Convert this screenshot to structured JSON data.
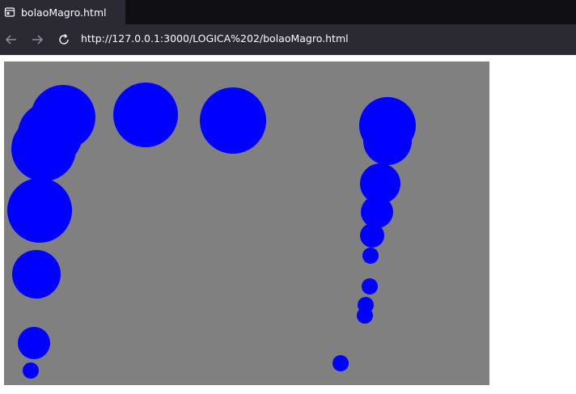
{
  "tab": {
    "title": "bolaoMagro.html",
    "icon": "page-icon"
  },
  "nav": {
    "back_icon": "back-arrow-icon",
    "forward_icon": "forward-arrow-icon",
    "reload_icon": "reload-icon",
    "url": "http://127.0.0.1:3000/LOGICA%202/bolaoMagro.html"
  },
  "canvas": {
    "background_color": "#808080",
    "ball_color": "#0000ff"
  }
}
